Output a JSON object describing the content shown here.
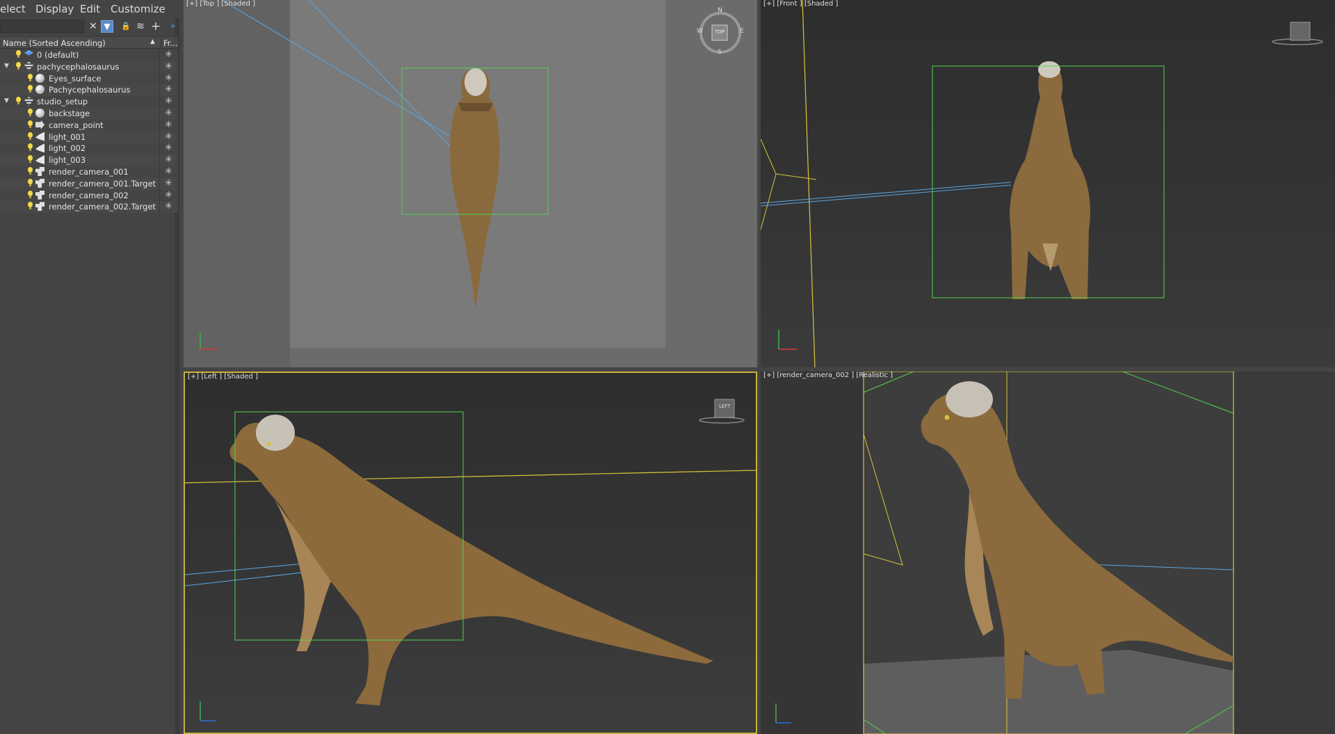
{
  "menu": [
    "elect",
    "Display",
    "Edit",
    "Customize"
  ],
  "toolbar": {
    "clear": "✕",
    "filter": "▼",
    "lock": "🔒",
    "layers": "≋",
    "add": "+",
    "more": "»"
  },
  "list": {
    "name_header": "Name (Sorted Ascending)",
    "sort_arrow": "▲",
    "fr_header": "Fr...",
    "rows": [
      {
        "label": "0 (default)",
        "icon": "layer-icon"
      },
      {
        "label": "pachycephalosaurus",
        "icon": "layers-icon"
      },
      {
        "label": "Eyes_surface",
        "icon": "sphere-icon"
      },
      {
        "label": "Pachycephalosaurus",
        "icon": "sphere-icon"
      },
      {
        "label": "studio_setup",
        "icon": "layers-icon"
      },
      {
        "label": "backstage",
        "icon": "sphere-icon"
      },
      {
        "label": "camera_point",
        "icon": "point-icon"
      },
      {
        "label": "light_001",
        "icon": "light-icon"
      },
      {
        "label": "light_002",
        "icon": "light-icon"
      },
      {
        "label": "light_003",
        "icon": "light-icon"
      },
      {
        "label": "render_camera_001",
        "icon": "camera-icon"
      },
      {
        "label": "render_camera_001.Target",
        "icon": "camera-icon"
      },
      {
        "label": "render_camera_002",
        "icon": "camera-icon"
      },
      {
        "label": "render_camera_002.Target",
        "icon": "camera-icon"
      }
    ],
    "freeze_glyph": "✳"
  },
  "viewports": {
    "top": {
      "label": "[+] [Top ] [Shaded ]",
      "cube": "TOP",
      "compass": {
        "n": "N",
        "s": "S",
        "e": "E",
        "w": "W"
      }
    },
    "front": {
      "label": "[+] [Front ] [Shaded ]"
    },
    "left": {
      "label": "[+] [Left ] [Shaded ]",
      "cube": "LEFT"
    },
    "camera": {
      "label": "[+] [render_camera_002 ] [Realistic ]"
    }
  },
  "colors": {
    "bbox": "#4fd64f",
    "light_line": "#5aa8e6",
    "camera_line": "#d9c63a"
  }
}
